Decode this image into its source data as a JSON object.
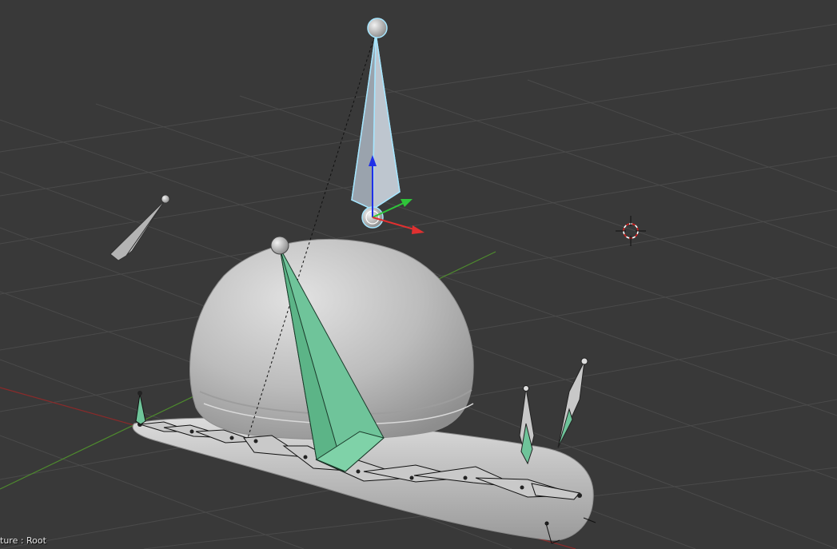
{
  "viewport": {
    "status_text": "ture : Root",
    "background_color": "#393939",
    "grid_color": "#4a4a4a",
    "x_axis_color": "#8a2a2a",
    "y_axis_color": "#4e8a2e"
  },
  "objects": {
    "mesh": "snail-body",
    "armature": "armature",
    "selected_bone": "Root",
    "cursor_icon": "3d-cursor-icon",
    "gizmo": "transform-manipulator-xyz"
  },
  "colors": {
    "mesh": "#b8b8b8",
    "bone_unselected": "#b4b4b4",
    "bone_selected_outline": "#a6e6ff",
    "bone_ik": "#6fc49a",
    "gizmo_x": "#e03030",
    "gizmo_y": "#2fc53a",
    "gizmo_z": "#2030e8"
  }
}
